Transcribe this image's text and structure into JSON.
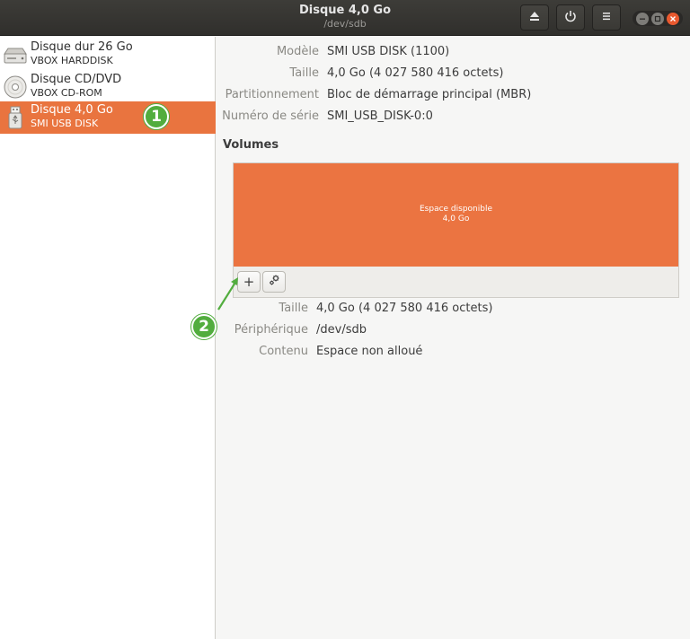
{
  "window": {
    "title": "Disque 4,0 Go",
    "subtitle": "/dev/sdb"
  },
  "header_buttons": [
    "eject-icon",
    "power-icon",
    "menu-icon"
  ],
  "sidebar": {
    "items": [
      {
        "name": "Disque dur 26 Go",
        "sub": "VBOX HARDDISK",
        "icon": "harddisk-icon",
        "selected": false
      },
      {
        "name": "Disque CD/DVD",
        "sub": "VBOX CD-ROM",
        "icon": "optical-disc-icon",
        "selected": false
      },
      {
        "name": "Disque 4,0 Go",
        "sub": "SMI USB DISK",
        "icon": "usb-drive-icon",
        "selected": true
      }
    ]
  },
  "annotations": {
    "badge1": "1",
    "badge2": "2"
  },
  "details": {
    "model_label": "Modèle",
    "model_value": "SMI USB DISK (1100)",
    "size_label": "Taille",
    "size_value": "4,0 Go (4 027 580 416 octets)",
    "partitioning_label": "Partitionnement",
    "partitioning_value": "Bloc de démarrage principal (MBR)",
    "serial_label": "Numéro de série",
    "serial_value": "SMI_USB_DISK-0:0"
  },
  "volumes": {
    "title": "Volumes",
    "segment_label": "Espace disponible",
    "segment_size": "4,0 Go",
    "add_label": "+",
    "size_label": "Taille",
    "size_value": "4,0 Go (4 027 580 416 octets)",
    "device_label": "Périphérique",
    "device_value": "/dev/sdb",
    "contents_label": "Contenu",
    "contents_value": "Espace non alloué"
  },
  "colors": {
    "accent": "#e9743f",
    "volume": "#eb7441",
    "badge": "#52ad3e",
    "titlebar": "#353431"
  }
}
